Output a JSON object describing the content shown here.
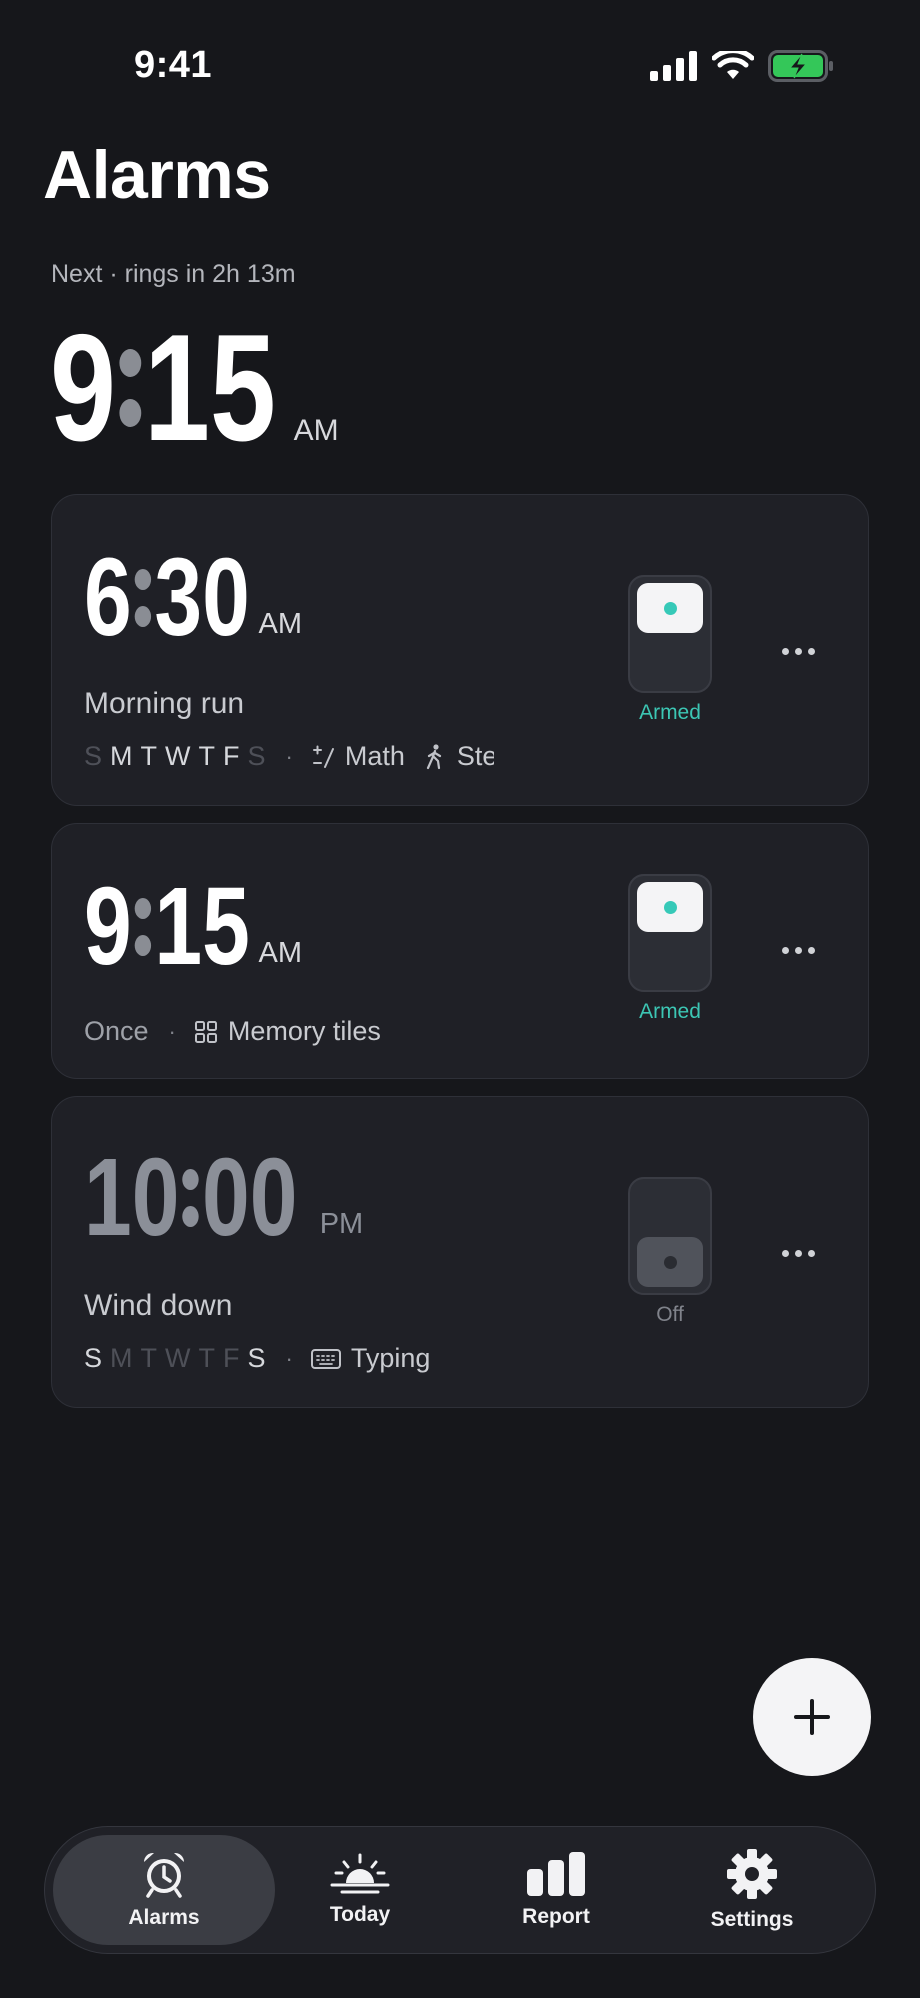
{
  "status_bar": {
    "time": "9:41",
    "icons": [
      "cellular-signal-icon",
      "wifi-icon",
      "battery-charging-icon"
    ],
    "battery_color": "#34c759"
  },
  "header": {
    "title": "Alarms",
    "next_label": "Next · rings in 2h 13m",
    "next_hour": "9",
    "next_minute": "15",
    "next_ampm": "AM"
  },
  "alarms": [
    {
      "hour": "6",
      "minute": "30",
      "ampm": "AM",
      "name": "Morning run",
      "days": [
        {
          "letter": "S",
          "active": false
        },
        {
          "letter": "M",
          "active": true
        },
        {
          "letter": "T",
          "active": true
        },
        {
          "letter": "W",
          "active": true
        },
        {
          "letter": "T",
          "active": true
        },
        {
          "letter": "F",
          "active": true
        },
        {
          "letter": "S",
          "active": false
        }
      ],
      "separator": "·",
      "challenges": [
        {
          "icon": "math-icon",
          "label": "Math"
        },
        {
          "icon": "walking-icon",
          "label": "Steps"
        }
      ],
      "status": "Armed",
      "enabled": true
    },
    {
      "hour": "9",
      "minute": "15",
      "ampm": "AM",
      "repeat": "Once",
      "separator": "·",
      "challenges": [
        {
          "icon": "grid-tiles-icon",
          "label": "Memory tiles"
        }
      ],
      "status": "Armed",
      "enabled": true
    },
    {
      "hour": "10",
      "minute": "00",
      "ampm": "PM",
      "name": "Wind down",
      "days": [
        {
          "letter": "S",
          "active": true
        },
        {
          "letter": "M",
          "active": false
        },
        {
          "letter": "T",
          "active": false
        },
        {
          "letter": "W",
          "active": false
        },
        {
          "letter": "T",
          "active": false
        },
        {
          "letter": "F",
          "active": false
        },
        {
          "letter": "S",
          "active": true
        }
      ],
      "separator": "·",
      "challenges": [
        {
          "icon": "keyboard-icon",
          "label": "Typing"
        }
      ],
      "status": "Off",
      "enabled": false
    }
  ],
  "fab": {
    "icon": "plus-icon"
  },
  "tabs": [
    {
      "label": "Alarms",
      "icon": "alarm-clock-icon",
      "active": true
    },
    {
      "label": "Today",
      "icon": "sunrise-icon",
      "active": false
    },
    {
      "label": "Report",
      "icon": "bar-chart-icon",
      "active": false
    },
    {
      "label": "Settings",
      "icon": "gear-icon",
      "active": false
    }
  ],
  "colors": {
    "background": "#16171b",
    "card": "#1f2026",
    "accent_armed": "#3cc6b4",
    "fab": "#f4f4f6"
  }
}
